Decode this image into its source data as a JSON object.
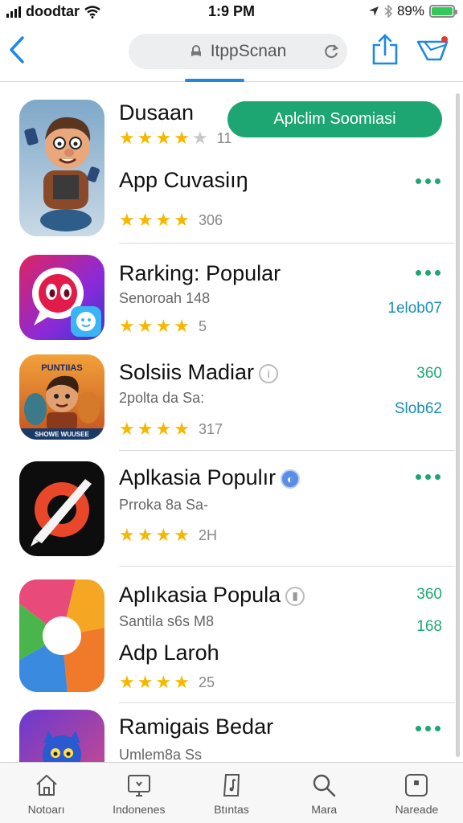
{
  "status_bar": {
    "carrier": "doodtar",
    "time": "1:9 PM",
    "battery": "89%"
  },
  "nav": {
    "search_text": "ItppScnan"
  },
  "apps": [
    {
      "title": "Dusaan",
      "rating_count": "11",
      "stars_filled": 4,
      "action_label": "Aplclim Soomiasi",
      "line2": "App Cuvasiıŋ",
      "line2_rating_count": "306"
    },
    {
      "title": "Rarking: Popular",
      "subtitle": "Senoroah 148",
      "rating_count": "5",
      "right_value": "1elob07"
    },
    {
      "title": "Solsiis Madiar",
      "subtitle": "2polta da Sa:",
      "rating_count": "317",
      "right_top": "360",
      "right_value": "Slob62",
      "icon_text_top": "PUNTIIAS",
      "icon_text_bottom": "SHOWE WUUSEE"
    },
    {
      "title": "Aplkasia Populır",
      "subtitle": "Prroka 8a Sa-",
      "rating_count": "2H"
    },
    {
      "title": "Aplıkasia Popula",
      "subtitle": "Santila s6s M8",
      "line2": "Adp Laroh",
      "rating_count": "25",
      "right_top": "360",
      "right_value": "168"
    },
    {
      "title": "Ramigais Bedar",
      "subtitle": "Umlem8a Ss"
    }
  ],
  "tabs": [
    {
      "label": "Notoarı",
      "icon": "home-icon"
    },
    {
      "label": "Indonenes",
      "icon": "tv-icon"
    },
    {
      "label": "Btıntas",
      "icon": "music-icon"
    },
    {
      "label": "Mara",
      "icon": "search-icon"
    },
    {
      "label": "Nareade",
      "icon": "box-icon"
    }
  ],
  "colors": {
    "accent_green": "#1ea672",
    "link_blue": "#1e88e5",
    "star": "#f5b800"
  }
}
